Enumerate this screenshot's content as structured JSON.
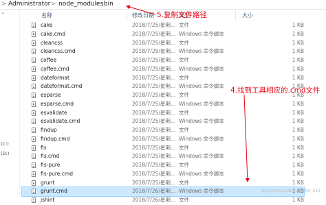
{
  "address_bar": {
    "segments": [
      "Administrator",
      "node_modules",
      ".bin"
    ],
    "separator": ">"
  },
  "sidebar": {
    "items": [
      "(C:)",
      "(D:)"
    ]
  },
  "columns": {
    "name": "名称",
    "date": "修改日期",
    "type": "类型",
    "size": "大小"
  },
  "files": [
    {
      "name": "cake",
      "date": "2018/7/25/星期...",
      "type": "文件",
      "size": "1 KB",
      "selected": false
    },
    {
      "name": "cake.cmd",
      "date": "2018/7/25/星期...",
      "type": "Windows 命令脚本",
      "size": "1 KB",
      "selected": false
    },
    {
      "name": "cleancss",
      "date": "2018/7/25/星期...",
      "type": "文件",
      "size": "1 KB",
      "selected": false
    },
    {
      "name": "cleancss.cmd",
      "date": "2018/7/25/星期...",
      "type": "Windows 命令脚本",
      "size": "1 KB",
      "selected": false
    },
    {
      "name": "coffee",
      "date": "2018/7/25/星期...",
      "type": "文件",
      "size": "1 KB",
      "selected": false
    },
    {
      "name": "coffee.cmd",
      "date": "2018/7/25/星期...",
      "type": "Windows 命令脚本",
      "size": "1 KB",
      "selected": false
    },
    {
      "name": "dateformat",
      "date": "2018/7/25/星期...",
      "type": "文件",
      "size": "1 KB",
      "selected": false
    },
    {
      "name": "dateformat.cmd",
      "date": "2018/7/25/星期...",
      "type": "Windows 命令脚本",
      "size": "1 KB",
      "selected": false
    },
    {
      "name": "esparse",
      "date": "2018/7/25/星期...",
      "type": "文件",
      "size": "1 KB",
      "selected": false
    },
    {
      "name": "esparse.cmd",
      "date": "2018/7/25/星期...",
      "type": "Windows 命令脚本",
      "size": "1 KB",
      "selected": false
    },
    {
      "name": "esvalidate",
      "date": "2018/7/25/星期...",
      "type": "文件",
      "size": "1 KB",
      "selected": false
    },
    {
      "name": "esvalidate.cmd",
      "date": "2018/7/25/星期...",
      "type": "Windows 命令脚本",
      "size": "1 KB",
      "selected": false
    },
    {
      "name": "findup",
      "date": "2018/7/25/星期...",
      "type": "文件",
      "size": "1 KB",
      "selected": false
    },
    {
      "name": "findup.cmd",
      "date": "2018/7/25/星期...",
      "type": "Windows 命令脚本",
      "size": "1 KB",
      "selected": false
    },
    {
      "name": "fis",
      "date": "2018/7/25/星期...",
      "type": "文件",
      "size": "1 KB",
      "selected": false
    },
    {
      "name": "fis.cmd",
      "date": "2018/7/25/星期...",
      "type": "Windows 命令脚本",
      "size": "1 KB",
      "selected": false
    },
    {
      "name": "fis-pure",
      "date": "2018/7/25/星期...",
      "type": "文件",
      "size": "1 KB",
      "selected": false
    },
    {
      "name": "fis-pure.cmd",
      "date": "2018/7/25/星期...",
      "type": "Windows 命令脚本",
      "size": "1 KB",
      "selected": false
    },
    {
      "name": "grunt",
      "date": "2018/7/25/星期...",
      "type": "文件",
      "size": "1 KB",
      "selected": false
    },
    {
      "name": "grunt.cmd",
      "date": "2018/7/26/星期...",
      "type": "Windows 命令脚本",
      "size": "1 KB",
      "selected": true
    },
    {
      "name": "jshint",
      "date": "2018/7/26/星期...",
      "type": "文件",
      "size": "1 KB",
      "selected": false
    }
  ],
  "annotations": {
    "copy_path": "5.复制文件路径",
    "find_file": "4.找到工具相应的.cmd文件"
  },
  "watermark": "http://blog.csdn.net/TAO_615",
  "colors": {
    "annotation": "#e60012",
    "selection": "#cce8ff",
    "header_text": "#4c607a"
  }
}
